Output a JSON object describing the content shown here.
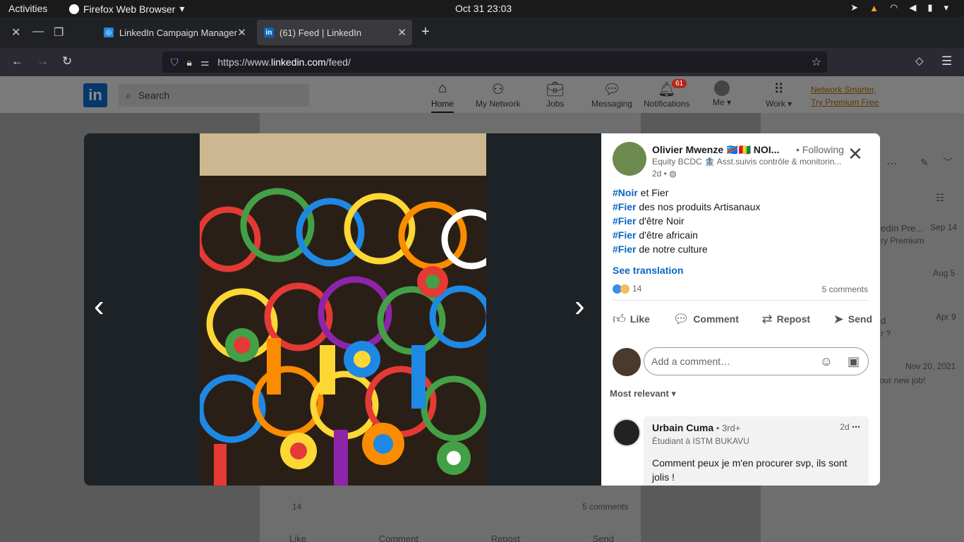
{
  "os_bar": {
    "activities": "Activities",
    "app_name": "Firefox Web Browser",
    "clock": "Oct 31  23:03"
  },
  "browser": {
    "tabs": [
      {
        "title": "LinkedIn Campaign Manager",
        "active": false
      },
      {
        "title": "(61) Feed | LinkedIn",
        "active": true
      }
    ],
    "url_prefix": "https://www.",
    "url_domain": "linkedin.com",
    "url_path": "/feed/"
  },
  "linkedin": {
    "logo": "in",
    "search_placeholder": "Search",
    "nav": [
      {
        "label": "Home",
        "icon": "home-icon"
      },
      {
        "label": "My Network",
        "icon": "network-icon"
      },
      {
        "label": "Jobs",
        "icon": "jobs-icon"
      },
      {
        "label": "Messaging",
        "icon": "messaging-icon"
      },
      {
        "label": "Notifications",
        "icon": "bell-icon",
        "badge": "61"
      },
      {
        "label": "Me",
        "icon": "avatar"
      },
      {
        "label": "Work",
        "icon": "grid-icon"
      }
    ],
    "premium_line1": "Network Smarter,",
    "premium_line2": "Try Premium Free"
  },
  "background_feed": {
    "reaction_count": "14",
    "comments": "5 comments",
    "actions": [
      "Like",
      "Comment",
      "Repost",
      "Send"
    ]
  },
  "background_right": {
    "items": [
      {
        "text": "edIn Pre...",
        "sub": "ry Premium",
        "date": "Sep 14"
      },
      {
        "text": "",
        "sub": "",
        "date": "Aug 5"
      },
      {
        "text": "d",
        "sub": "r ?",
        "date": "Apr 9"
      },
      {
        "text": "",
        "sub": "our new job!",
        "date": "Nov 20, 2021"
      }
    ]
  },
  "post": {
    "author": "Olivier Mwenze 🇨🇩🇬🇳 NOI...",
    "following": "• Following",
    "headline": "Equity BCDC 🏦 Asst.suivis contrôle & monitorin...",
    "time": "2d •",
    "lines": [
      {
        "tag": "#Noir",
        "text": " et Fier"
      },
      {
        "tag": "#Fier",
        "text": " des nos produits Artisanaux"
      },
      {
        "tag": "#Fier",
        "text": " d'être Noir"
      },
      {
        "tag": "#Fier",
        "text": " d'être africain"
      },
      {
        "tag": "#Fier",
        "text": " de notre culture"
      }
    ],
    "see_translation": "See translation",
    "reaction_count": "14",
    "comment_count": "5 comments",
    "actions": {
      "like": "Like",
      "comment": "Comment",
      "repost": "Repost",
      "send": "Send"
    },
    "add_comment_placeholder": "Add a comment…",
    "sort_label": "Most relevant ▾",
    "top_comment": {
      "name": "Urbain Cuma",
      "degree": " • 3rd+",
      "headline": "Étudiant à ISTM BUKAVU",
      "time": "2d",
      "text": "Comment peux je m'en procurer svp, ils sont jolis !"
    }
  },
  "colors": {
    "linkedin_blue": "#0a66c2",
    "viewer_bg": "#1d2226",
    "overlay": "#5a5a5a"
  }
}
